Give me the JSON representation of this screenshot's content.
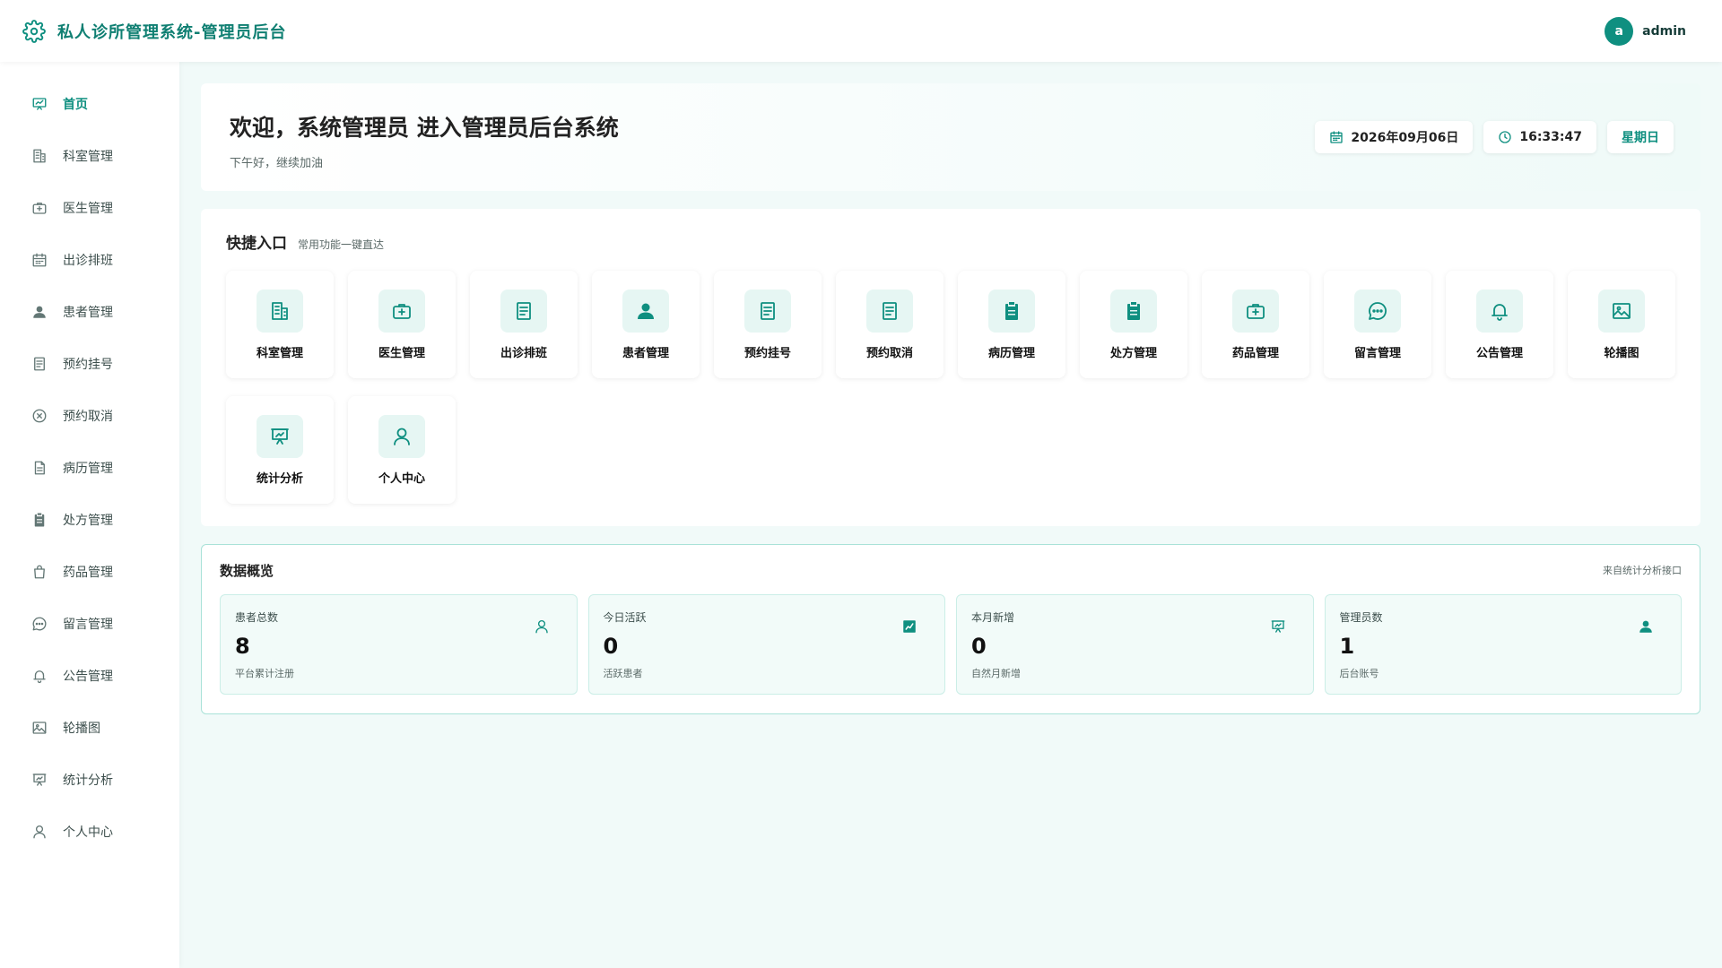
{
  "header": {
    "title": "私人诊所管理系统-管理员后台",
    "brand_icon": "gear-icon",
    "avatar_letter": "a",
    "username": "admin"
  },
  "colors": {
    "accent": "#0f8f80",
    "background": "#f1faf9",
    "tile_icon_bg": "#e6f6f3"
  },
  "sidebar": {
    "items": [
      {
        "label": "首页",
        "icon": "statistics-board-icon",
        "active": true
      },
      {
        "label": "科室管理",
        "icon": "building-icon"
      },
      {
        "label": "医生管理",
        "icon": "medical-kit-icon"
      },
      {
        "label": "出诊排班",
        "icon": "calendar-icon"
      },
      {
        "label": "患者管理",
        "icon": "user-filled-icon"
      },
      {
        "label": "预约挂号",
        "icon": "document-icon"
      },
      {
        "label": "预约取消",
        "icon": "circle-close-icon"
      },
      {
        "label": "病历管理",
        "icon": "file-text-icon"
      },
      {
        "label": "处方管理",
        "icon": "clipboard-icon"
      },
      {
        "label": "药品管理",
        "icon": "bag-icon"
      },
      {
        "label": "留言管理",
        "icon": "chat-icon"
      },
      {
        "label": "公告管理",
        "icon": "bell-icon"
      },
      {
        "label": "轮播图",
        "icon": "image-icon"
      },
      {
        "label": "统计分析",
        "icon": "presentation-chart-icon"
      },
      {
        "label": "个人中心",
        "icon": "user-outline-icon"
      }
    ]
  },
  "welcome": {
    "title": "欢迎，系统管理员 进入管理员后台系统",
    "subtitle": "下午好，继续加油",
    "date": "2026年09月06日",
    "time": "16:33:47",
    "weekday": "星期日"
  },
  "quick": {
    "title": "快捷入口",
    "hint": "常用功能一键直达",
    "tiles": [
      {
        "label": "科室管理",
        "icon": "building-icon"
      },
      {
        "label": "医生管理",
        "icon": "medical-kit-icon"
      },
      {
        "label": "出诊排班",
        "icon": "document-icon"
      },
      {
        "label": "患者管理",
        "icon": "user-filled-icon"
      },
      {
        "label": "预约挂号",
        "icon": "document-icon"
      },
      {
        "label": "预约取消",
        "icon": "document-icon"
      },
      {
        "label": "病历管理",
        "icon": "clipboard-icon"
      },
      {
        "label": "处方管理",
        "icon": "clipboard-icon"
      },
      {
        "label": "药品管理",
        "icon": "medical-kit-icon"
      },
      {
        "label": "留言管理",
        "icon": "chat-icon"
      },
      {
        "label": "公告管理",
        "icon": "bell-icon"
      },
      {
        "label": "轮播图",
        "icon": "image-icon"
      },
      {
        "label": "统计分析",
        "icon": "presentation-chart-icon"
      },
      {
        "label": "个人中心",
        "icon": "user-outline-icon"
      }
    ]
  },
  "overview": {
    "title": "数据概览",
    "source": "来自统计分析接口",
    "stats": [
      {
        "label": "患者总数",
        "value": "8",
        "desc": "平台累计注册",
        "icon": "user-outline-icon"
      },
      {
        "label": "今日活跃",
        "value": "0",
        "desc": "活跃患者",
        "icon": "trend-chart-icon"
      },
      {
        "label": "本月新增",
        "value": "0",
        "desc": "自然月新增",
        "icon": "presentation-chart-icon"
      },
      {
        "label": "管理员数",
        "value": "1",
        "desc": "后台账号",
        "icon": "user-filled-icon"
      }
    ]
  }
}
